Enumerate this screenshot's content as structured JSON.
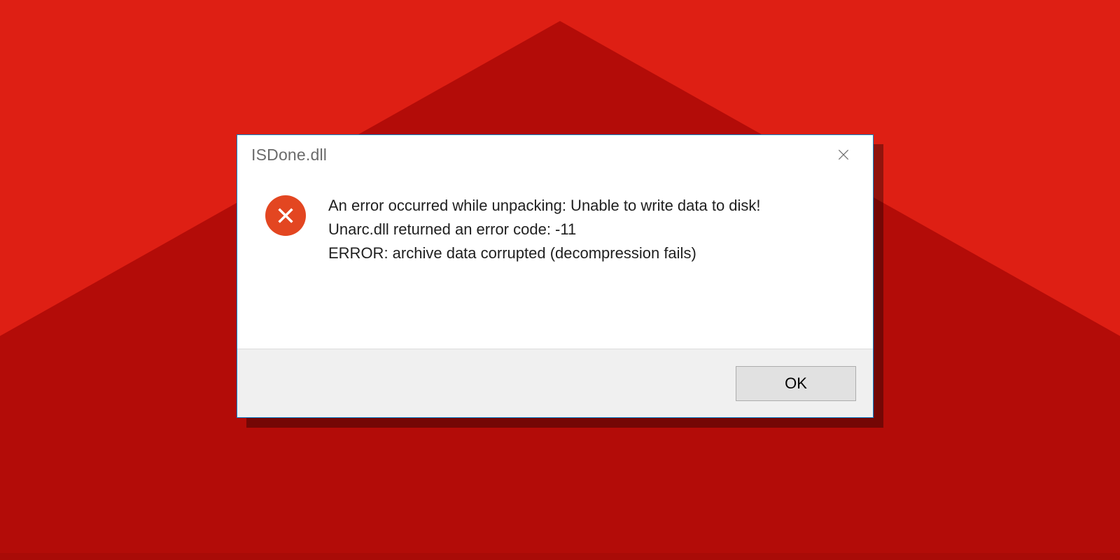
{
  "dialog": {
    "title": "ISDone.dll",
    "message": {
      "line1": "An error occurred while unpacking: Unable to write data to disk!",
      "line2": "Unarc.dll returned an error code: -11",
      "line3": "ERROR: archive data corrupted (decompression fails)"
    },
    "ok_label": "OK"
  }
}
